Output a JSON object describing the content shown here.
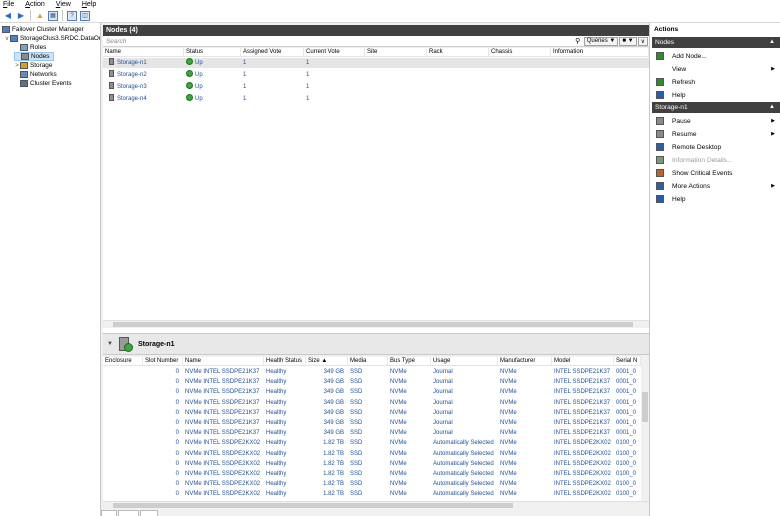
{
  "menu": [
    "File",
    "Action",
    "View",
    "Help"
  ],
  "tree": {
    "items": [
      {
        "label": "Failover Cluster Manager",
        "level": 0,
        "expander": ""
      },
      {
        "label": "StorageClus3.SRDC.DataOn",
        "level": 1,
        "expander": "v"
      },
      {
        "label": "Roles",
        "level": 2,
        "expander": ""
      },
      {
        "label": "Nodes",
        "level": 2,
        "expander": "",
        "selected": true
      },
      {
        "label": "Storage",
        "level": 2,
        "expander": ">"
      },
      {
        "label": "Networks",
        "level": 2,
        "expander": ""
      },
      {
        "label": "Cluster Events",
        "level": 2,
        "expander": ""
      }
    ]
  },
  "nodes_pane": {
    "title": "Nodes (4)",
    "search_placeholder": "Search",
    "queries_label": "Queries",
    "columns": [
      "Name",
      "Status",
      "Assigned Vote",
      "Current Vote",
      "Site",
      "Rack",
      "Chassis",
      "Information"
    ],
    "rows": [
      {
        "name": "Storage-n1",
        "status": "Up",
        "assigned": "1",
        "current": "1"
      },
      {
        "name": "Storage-n2",
        "status": "Up",
        "assigned": "1",
        "current": "1"
      },
      {
        "name": "Storage-n3",
        "status": "Up",
        "assigned": "1",
        "current": "1"
      },
      {
        "name": "Storage-n4",
        "status": "Up",
        "assigned": "1",
        "current": "1"
      }
    ]
  },
  "details": {
    "title": "Storage-n1",
    "columns": [
      "Enclosure",
      "Slot Number",
      "Name",
      "Health Status",
      "Size",
      "Media",
      "Bus Type",
      "Usage",
      "Manufacturer",
      "Model",
      "Serial N"
    ],
    "sort_indicator": "▲",
    "rows": [
      {
        "slot": "0",
        "name": "NVMe INTEL SSDPE21K37",
        "health": "Healthy",
        "size": "349 GB",
        "media": "SSD",
        "bus": "NVMe",
        "usage": "Journal",
        "mfr": "NVMe",
        "model": "INTEL SSDPE21K37",
        "serial": "0001_0"
      },
      {
        "slot": "0",
        "name": "NVMe INTEL SSDPE21K37",
        "health": "Healthy",
        "size": "349 GB",
        "media": "SSD",
        "bus": "NVMe",
        "usage": "Journal",
        "mfr": "NVMe",
        "model": "INTEL SSDPE21K37",
        "serial": "0001_0"
      },
      {
        "slot": "0",
        "name": "NVMe INTEL SSDPE21K37",
        "health": "Healthy",
        "size": "349 GB",
        "media": "SSD",
        "bus": "NVMe",
        "usage": "Journal",
        "mfr": "NVMe",
        "model": "INTEL SSDPE21K37",
        "serial": "0001_0"
      },
      {
        "slot": "0",
        "name": "NVMe INTEL SSDPE21K37",
        "health": "Healthy",
        "size": "349 GB",
        "media": "SSD",
        "bus": "NVMe",
        "usage": "Journal",
        "mfr": "NVMe",
        "model": "INTEL SSDPE21K37",
        "serial": "0001_0"
      },
      {
        "slot": "0",
        "name": "NVMe INTEL SSDPE21K37",
        "health": "Healthy",
        "size": "349 GB",
        "media": "SSD",
        "bus": "NVMe",
        "usage": "Journal",
        "mfr": "NVMe",
        "model": "INTEL SSDPE21K37",
        "serial": "0001_0"
      },
      {
        "slot": "0",
        "name": "NVMe INTEL SSDPE21K37",
        "health": "Healthy",
        "size": "349 GB",
        "media": "SSD",
        "bus": "NVMe",
        "usage": "Journal",
        "mfr": "NVMe",
        "model": "INTEL SSDPE21K37",
        "serial": "0001_0"
      },
      {
        "slot": "0",
        "name": "NVMe INTEL SSDPE21K37",
        "health": "Healthy",
        "size": "349 GB",
        "media": "SSD",
        "bus": "NVMe",
        "usage": "Journal",
        "mfr": "NVMe",
        "model": "INTEL SSDPE21K37",
        "serial": "0001_0"
      },
      {
        "slot": "0",
        "name": "NVMe INTEL SSDPE2KX02",
        "health": "Healthy",
        "size": "1.82 TB",
        "media": "SSD",
        "bus": "NVMe",
        "usage": "Automatically Selected",
        "mfr": "NVMe",
        "model": "INTEL SSDPE2KX02",
        "serial": "0100_0"
      },
      {
        "slot": "0",
        "name": "NVMe INTEL SSDPE2KX02",
        "health": "Healthy",
        "size": "1.82 TB",
        "media": "SSD",
        "bus": "NVMe",
        "usage": "Automatically Selected",
        "mfr": "NVMe",
        "model": "INTEL SSDPE2KX02",
        "serial": "0100_0"
      },
      {
        "slot": "0",
        "name": "NVMe INTEL SSDPE2KX02",
        "health": "Healthy",
        "size": "1.82 TB",
        "media": "SSD",
        "bus": "NVMe",
        "usage": "Automatically Selected",
        "mfr": "NVMe",
        "model": "INTEL SSDPE2KX02",
        "serial": "0100_0"
      },
      {
        "slot": "0",
        "name": "NVMe INTEL SSDPE2KX02",
        "health": "Healthy",
        "size": "1.82 TB",
        "media": "SSD",
        "bus": "NVMe",
        "usage": "Automatically Selected",
        "mfr": "NVMe",
        "model": "INTEL SSDPE2KX02",
        "serial": "0100_0"
      },
      {
        "slot": "0",
        "name": "NVMe INTEL SSDPE2KX02",
        "health": "Healthy",
        "size": "1.82 TB",
        "media": "SSD",
        "bus": "NVMe",
        "usage": "Automatically Selected",
        "mfr": "NVMe",
        "model": "INTEL SSDPE2KX02",
        "serial": "0100_0"
      },
      {
        "slot": "0",
        "name": "NVMe INTEL SSDPE2KX02",
        "health": "Healthy",
        "size": "1.82 TB",
        "media": "SSD",
        "bus": "NVMe",
        "usage": "Automatically Selected",
        "mfr": "NVMe",
        "model": "INTEL SSDPE2KX02",
        "serial": "0100_0"
      },
      {
        "slot": "0",
        "name": "NVMe INTEL SSDPE2KX02",
        "health": "Healthy",
        "size": "1.82 TB",
        "media": "SSD",
        "bus": "NVMe",
        "usage": "Automatically Selected",
        "mfr": "NVMe",
        "model": "INTEL SSDPE2KX02",
        "serial": "0100_0"
      }
    ]
  },
  "actions": {
    "title": "Actions",
    "sections": [
      {
        "header": "Nodes",
        "items": [
          {
            "label": "Add Node...",
            "icon": "add-node-icon",
            "color": "#2e8b2e",
            "submenu": false,
            "disabled": false
          },
          {
            "label": "View",
            "icon": "",
            "color": "",
            "submenu": true,
            "disabled": false
          },
          {
            "label": "Refresh",
            "icon": "refresh-icon",
            "color": "#2e8b2e",
            "submenu": false,
            "disabled": false
          },
          {
            "label": "Help",
            "icon": "help-icon",
            "color": "#1f5fb8",
            "submenu": false,
            "disabled": false
          }
        ]
      },
      {
        "header": "Storage-n1",
        "items": [
          {
            "label": "Pause",
            "icon": "pause-icon",
            "color": "#8a8a8a",
            "submenu": true,
            "disabled": false
          },
          {
            "label": "Resume",
            "icon": "resume-icon",
            "color": "#8a8a8a",
            "submenu": true,
            "disabled": false
          },
          {
            "label": "Remote Desktop",
            "icon": "remote-desktop-icon",
            "color": "#2f5ea8",
            "submenu": false,
            "disabled": false
          },
          {
            "label": "Information Details...",
            "icon": "information-details-icon",
            "color": "#7a9a7a",
            "submenu": false,
            "disabled": true
          },
          {
            "label": "Show Critical Events",
            "icon": "critical-events-icon",
            "color": "#c06030",
            "submenu": false,
            "disabled": false
          },
          {
            "label": "More Actions",
            "icon": "more-actions-icon",
            "color": "#2f5ea8",
            "submenu": true,
            "disabled": false
          },
          {
            "label": "Help",
            "icon": "help-icon",
            "color": "#1f5fb8",
            "submenu": false,
            "disabled": false
          }
        ]
      }
    ]
  },
  "colors": {
    "header_dark": "#404040",
    "link_blue": "#1f4f9e",
    "status_up": "#3ea63e",
    "selection": "#cde3f8"
  }
}
